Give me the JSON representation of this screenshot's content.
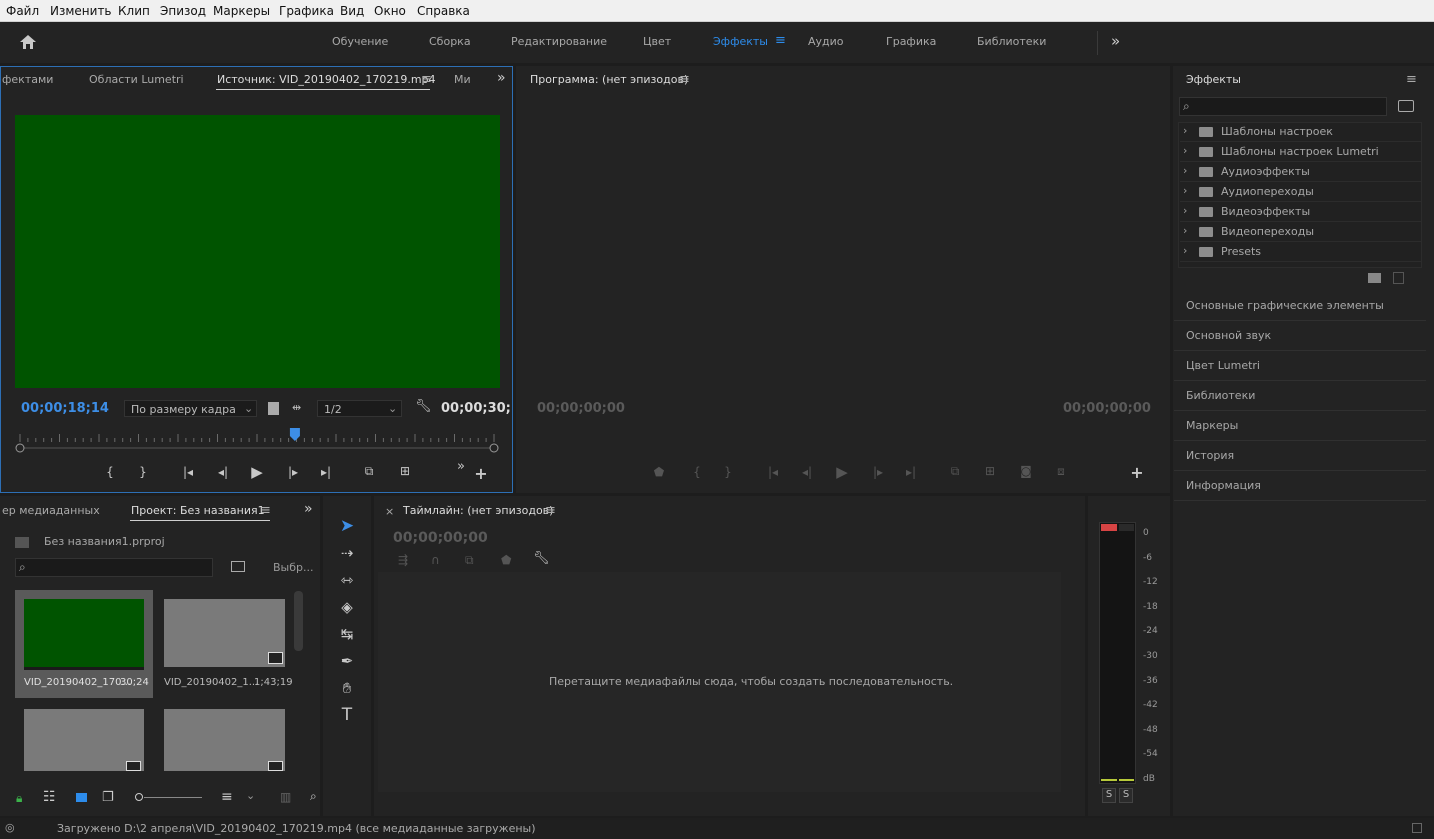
{
  "menu": [
    "Файл",
    "Изменить",
    "Клип",
    "Эпизод",
    "Маркеры",
    "Графика",
    "Вид",
    "Окно",
    "Справка"
  ],
  "workspaces": {
    "items": [
      "Обучение",
      "Сборка",
      "Редактирование",
      "Цвет",
      "Эффекты",
      "Аудио",
      "Графика",
      "Библиотеки"
    ],
    "active": "Эффекты",
    "more": "»"
  },
  "source_panel": {
    "tabs": [
      "фектами",
      "Области Lumetri",
      "Источник: VID_20190402_170219.mp4",
      "Ми"
    ],
    "timecode_in": "00;00;18;14",
    "fit": "По размеру кадра",
    "resolution": "1/2",
    "timecode_out": "00;00;30;",
    "playhead_fraction": 0.58,
    "video_color": "#005400"
  },
  "program_panel": {
    "title": "Программа: (нет эпизодов)",
    "timecode_left": "00;00;00;00",
    "timecode_right": "00;00;00;00"
  },
  "effects_panel": {
    "title": "Эффекты",
    "items": [
      "Шаблоны настроек",
      "Шаблоны настроек Lumetri",
      "Аудиоэффекты",
      "Аудиопереходы",
      "Видеоэффекты",
      "Видеопереходы",
      "Presets"
    ],
    "collapsed": [
      "Основные графические элементы",
      "Основной звук",
      "Цвет Lumetri",
      "Библиотеки",
      "Маркеры",
      "История",
      "Информация"
    ]
  },
  "project_panel": {
    "tabs": [
      "ер медиаданных",
      "Проект: Без названия1"
    ],
    "file": "Без названия1.prproj",
    "select_label": "Выбр...",
    "clips": [
      {
        "name": "VID_20190402_170...",
        "duration": "30;24"
      },
      {
        "name": "VID_20190402_1...",
        "duration": "1;43;19"
      },
      {
        "name": "",
        "duration": ""
      },
      {
        "name": "",
        "duration": ""
      }
    ]
  },
  "timeline_panel": {
    "title": "Таймлайн: (нет эпизодов)",
    "timecode": "00;00;00;00",
    "hint": "Перетащите медиафайлы сюда, чтобы создать последовательность."
  },
  "audio_meter": {
    "labels": [
      "0",
      "-6",
      "-12",
      "-18",
      "-24",
      "-30",
      "-36",
      "-42",
      "-48",
      "-54",
      "dB"
    ],
    "solo": [
      "S",
      "S"
    ]
  },
  "status": "Загружено D:\\2 апреля\\VID_20190402_170219.mp4 (все медиаданные загружены)",
  "colors": {
    "accent": "#2d8ceb",
    "panel": "#232323",
    "bg": "#1d1d1d",
    "clip_green": "#005400"
  }
}
